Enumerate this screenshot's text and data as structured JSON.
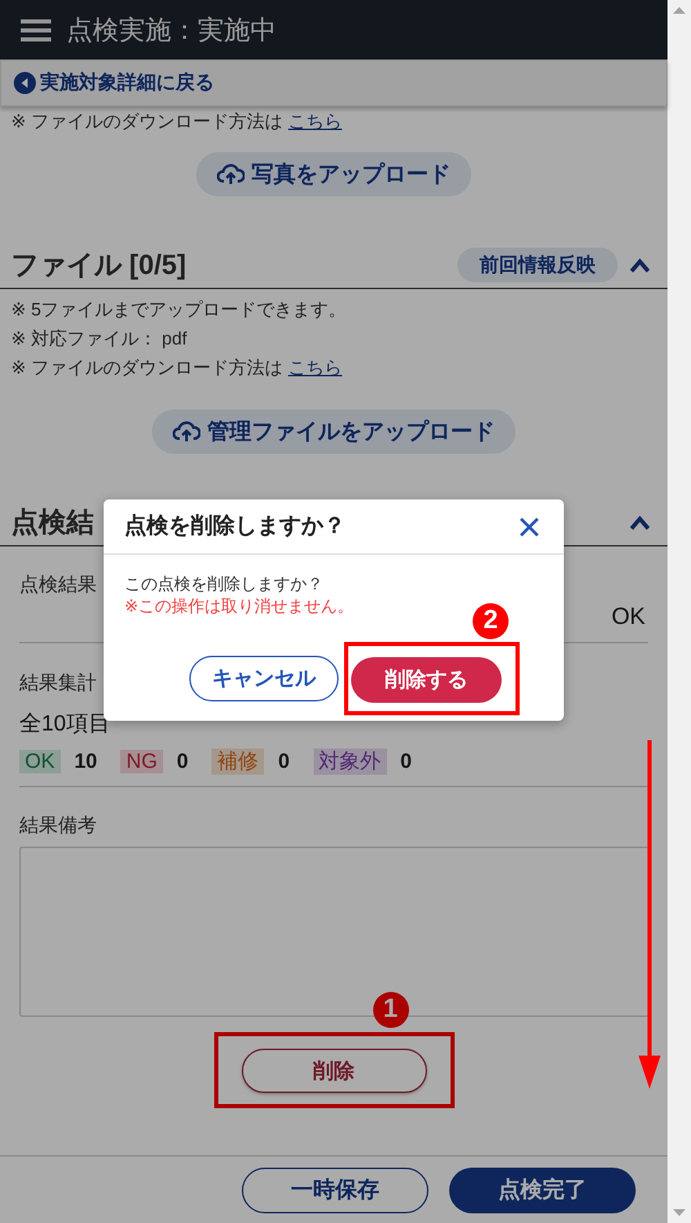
{
  "header": {
    "title": "点検実施：実施中"
  },
  "back_link": {
    "label": "実施対象詳細に戻る"
  },
  "photo_section": {
    "notes": [
      {
        "text": "※ ファイルのダウンロード方法は",
        "link": "こちら"
      }
    ],
    "upload_button": "写真をアップロード"
  },
  "file_section": {
    "title": "ファイル [0/5]",
    "reflect_button": "前回情報反映",
    "expanded": true,
    "notes": [
      {
        "text": "※ 5ファイルまでアップロードできます。"
      },
      {
        "text": "※ 対応ファイル： pdf"
      },
      {
        "text": "※ ファイルのダウンロード方法は",
        "link": "こちら"
      }
    ],
    "upload_button": "管理ファイルをアップロード"
  },
  "result_section": {
    "title": "点検結",
    "expanded": true,
    "result_label": "点検結果",
    "result_value": "OK",
    "summary_label": "結果集計",
    "total": "全10項目",
    "counts": [
      {
        "label": "OK",
        "value": "10",
        "kind": "ok"
      },
      {
        "label": "NG",
        "value": "0",
        "kind": "ng"
      },
      {
        "label": "補修",
        "value": "0",
        "kind": "repair"
      },
      {
        "label": "対象外",
        "value": "0",
        "kind": "excluded"
      }
    ],
    "remarks_label": "結果備考",
    "delete_button": "削除"
  },
  "footer": {
    "buttons": [
      {
        "label": "一時保存",
        "kind": "outline"
      },
      {
        "label": "点検完了",
        "kind": "primary"
      }
    ]
  },
  "dialog": {
    "title": "点検を削除しますか？",
    "message": "この点検を削除しますか？",
    "warning": "※この操作は取り消せません。",
    "buttons": [
      {
        "label": "キャンセル",
        "kind": "outline"
      },
      {
        "label": "削除する",
        "kind": "danger"
      }
    ]
  },
  "annotations": [
    {
      "number": "1"
    },
    {
      "number": "2"
    }
  ]
}
